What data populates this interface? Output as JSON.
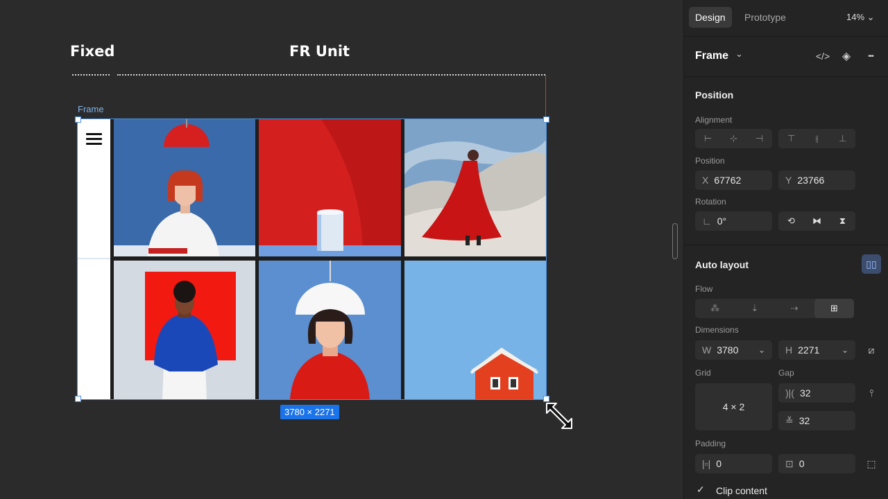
{
  "canvas": {
    "headers": {
      "fixed": "Fixed",
      "fr_unit": "FR Unit"
    },
    "frame_label": "Frame",
    "dimension_badge": "3780 × 2271"
  },
  "panel": {
    "tabs": {
      "design": "Design",
      "prototype": "Prototype"
    },
    "zoom": "14% ⌄",
    "frame_title": "Frame",
    "frame_chevron": "⌄",
    "code_icon": "</>",
    "component_icon": "◈",
    "more_icon": "•••",
    "position": {
      "title": "Position",
      "alignment_label": "Alignment",
      "position_label": "Position",
      "x_prefix": "X",
      "x_value": "67762",
      "y_prefix": "Y",
      "y_value": "23766",
      "rotation_label": "Rotation",
      "rotation_prefix": "∟",
      "rotation_value": "0°"
    },
    "auto_layout": {
      "title": "Auto layout",
      "flow_label": "Flow",
      "dimensions_label": "Dimensions",
      "w_prefix": "W",
      "w_value": "3780",
      "w_mode": "⌄",
      "h_prefix": "H",
      "h_value": "2271",
      "h_mode": "⌄",
      "grid_label": "Grid",
      "grid_value": "4 × 2",
      "gap_label": "Gap",
      "gap_h_prefix": ")|(",
      "gap_h": "32",
      "gap_v_prefix": "≚",
      "gap_v": "32",
      "padding_label": "Padding",
      "pad_h_prefix": "|▫|",
      "pad_h": "0",
      "pad_v_prefix": "⊡",
      "pad_v": "0",
      "clip_check": "✓",
      "clip_label": "Clip content"
    }
  }
}
